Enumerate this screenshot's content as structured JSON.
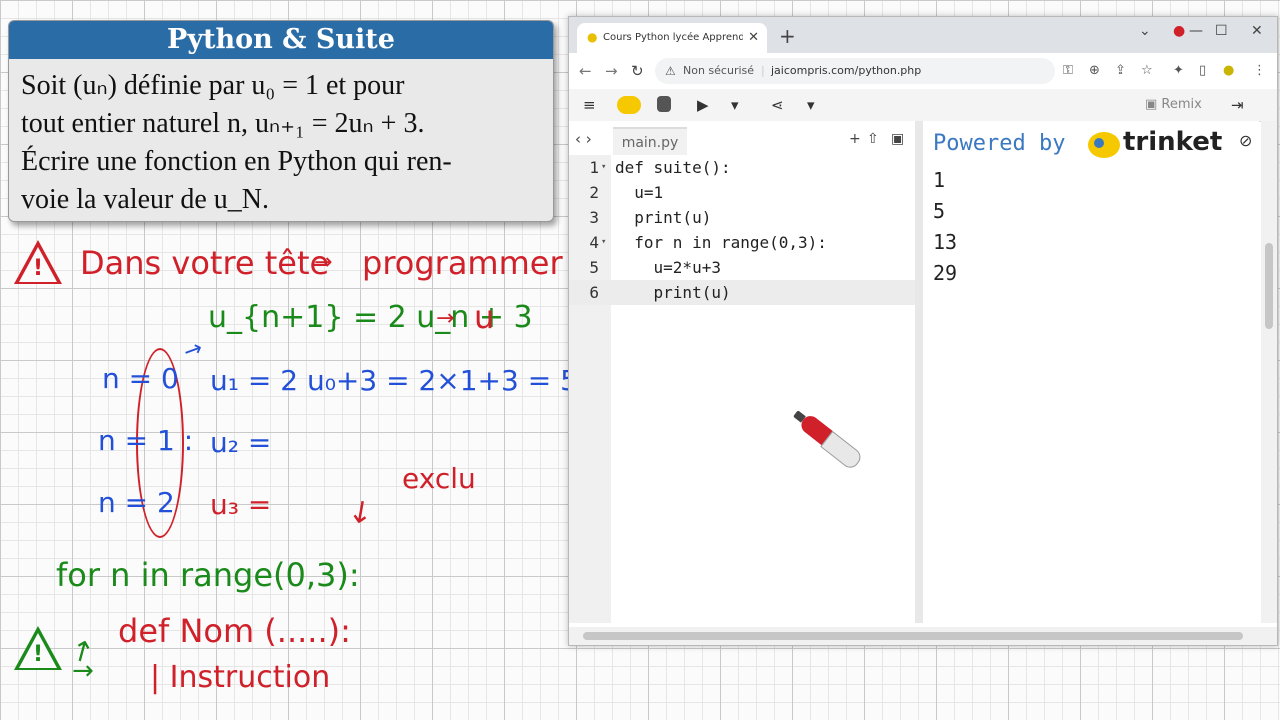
{
  "problem": {
    "title": "Python & Suite",
    "lines": [
      "Soit (uₙ) définie par u₀ = 1 et pour",
      "tout entier naturel n, uₙ₊₁ = 2uₙ + 3.",
      "Écrire une fonction en Python qui ren-",
      "voie la valeur de u_N."
    ]
  },
  "notes": {
    "heading": "Dans votre tête",
    "heading_target": "programmer",
    "recurrence": "u_{n+1} = 2 u_n + 3",
    "recurrence_target": "u",
    "n_values": [
      "n = 0",
      "n = 1 :",
      "n = 2"
    ],
    "computations": [
      "u₁ = 2 u₀+3 = 2×1+3 = 5",
      "u₂ =",
      "u₃ ="
    ],
    "excluded": "exclu",
    "for_line": "for n in range(0,3):",
    "def_line": "def Nom (.....):",
    "instruction": "| Instruction"
  },
  "browser": {
    "tab_title": "Cours Python lycée Apprendre à",
    "new_tab": "+",
    "not_secure": "Non sécurisé",
    "url": "jaicompris.com/python.php",
    "remix": "Remix",
    "file_tab": "main.py",
    "code_lines": [
      {
        "num": "1",
        "text": "def suite():"
      },
      {
        "num": "2",
        "text": "  u=1"
      },
      {
        "num": "3",
        "text": "  print(u)"
      },
      {
        "num": "4",
        "text": "  for n in range(0,3):"
      },
      {
        "num": "5",
        "text": "    u=2*u+3"
      },
      {
        "num": "6",
        "text": "    print(u)"
      }
    ],
    "powered_by": "Powered by",
    "brand": "trinket",
    "output": [
      "1",
      "5",
      "13",
      "29"
    ]
  },
  "colors": {
    "title_bar": "#2a6ca6",
    "note_red": "#d0202a",
    "note_green": "#1a8a1a",
    "note_blue": "#2350d8",
    "powered_blue": "#3b78c2"
  }
}
